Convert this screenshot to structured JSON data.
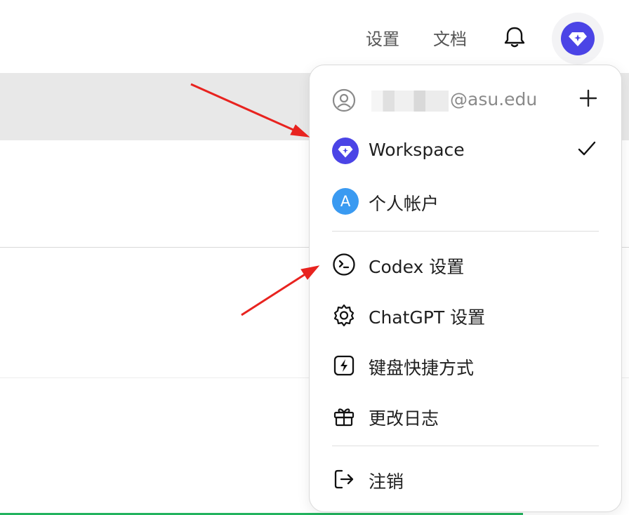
{
  "header": {
    "settings_label": "设置",
    "docs_label": "文档",
    "bell_icon": "bell-icon",
    "avatar_icon": "diamond-icon"
  },
  "menu": {
    "account_email_domain": "@asu.edu",
    "add_icon": "plus-icon",
    "workspace_label": "Workspace",
    "workspace_selected": true,
    "personal_avatar_letter": "A",
    "personal_label": "个人帐户",
    "items": [
      {
        "label": "Codex 设置",
        "icon": "terminal-icon"
      },
      {
        "label": "ChatGPT 设置",
        "icon": "gear-icon"
      },
      {
        "label": "键盘快捷方式",
        "icon": "lightning-icon"
      },
      {
        "label": "更改日志",
        "icon": "gift-icon"
      }
    ],
    "logout_label": "注销",
    "logout_icon": "logout-icon"
  },
  "colors": {
    "accent": "#4b44e6",
    "personal_avatar": "#3a9af1",
    "annotation_arrow": "#e8231f",
    "progress_bar": "#22b35e"
  }
}
